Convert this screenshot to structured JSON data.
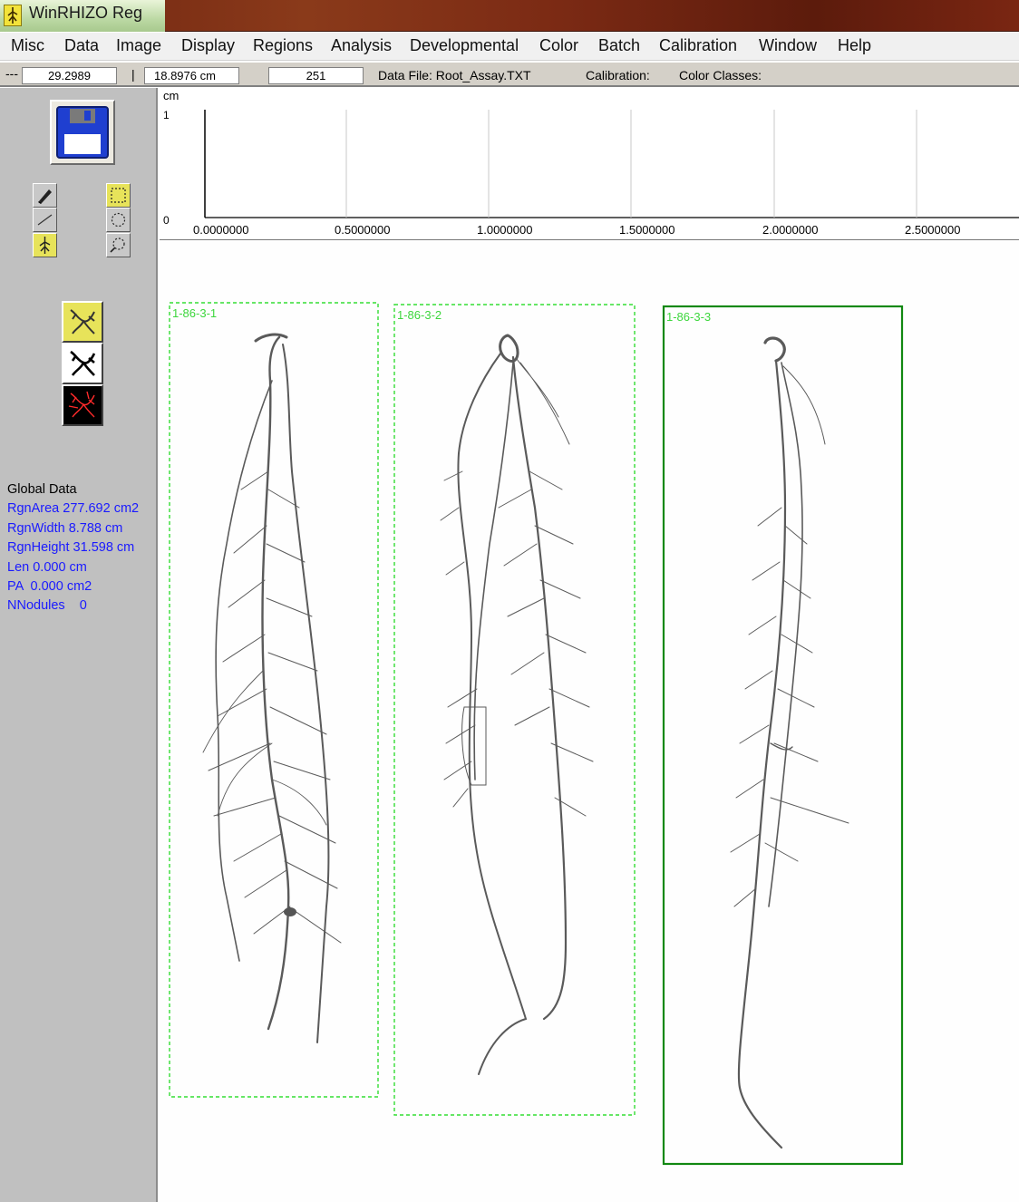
{
  "titlebar": {
    "title": "WinRHIZO Reg",
    "icon": "root-app-icon"
  },
  "menu": [
    "Misc",
    "Data",
    "Image",
    "Display",
    "Regions",
    "Analysis",
    "Developmental",
    "Color",
    "Batch",
    "Calibration",
    "Window",
    "Help"
  ],
  "toolbar": {
    "dash": "---",
    "field1": "29.2989",
    "separator": "|",
    "field2": "18.8976 cm",
    "field3": "251",
    "data_file": "Data File: Root_Assay.TXT",
    "calibration": "Calibration:",
    "color_classes": "Color Classes:"
  },
  "sidebar": {
    "save_icon": "floppy-disk-icon",
    "tools": [
      "pencil-icon",
      "region-select-icon",
      "line-icon",
      "circle-select-icon",
      "root-tool-icon",
      "zoom-icon"
    ],
    "views": [
      "root-view-gray-icon",
      "root-view-bw-icon",
      "root-view-skeleton-icon"
    ]
  },
  "global_data": {
    "title": "Global Data",
    "rows": [
      "RgnArea 277.692 cm2",
      "RgnWidth 8.788 cm",
      "RgnHeight 31.598 cm",
      "Len 0.000 cm",
      "PA  0.000 cm2",
      "NNodules    0"
    ]
  },
  "graph": {
    "unit": "cm",
    "y_max_label": "1",
    "y_min_label": "0",
    "x_labels": [
      "0.0000000",
      "0.5000000",
      "1.0000000",
      "1.5000000",
      "2.0000000",
      "2.5000000"
    ]
  },
  "regions": [
    {
      "label": "1-86-3-1",
      "selected": false
    },
    {
      "label": "1-86-3-2",
      "selected": false
    },
    {
      "label": "1-86-3-3",
      "selected": true
    }
  ],
  "colors": {
    "roi_green": "#33dd33",
    "selected_green": "#118811",
    "stats_blue": "#1a1aff",
    "root_gray": "#555555"
  }
}
